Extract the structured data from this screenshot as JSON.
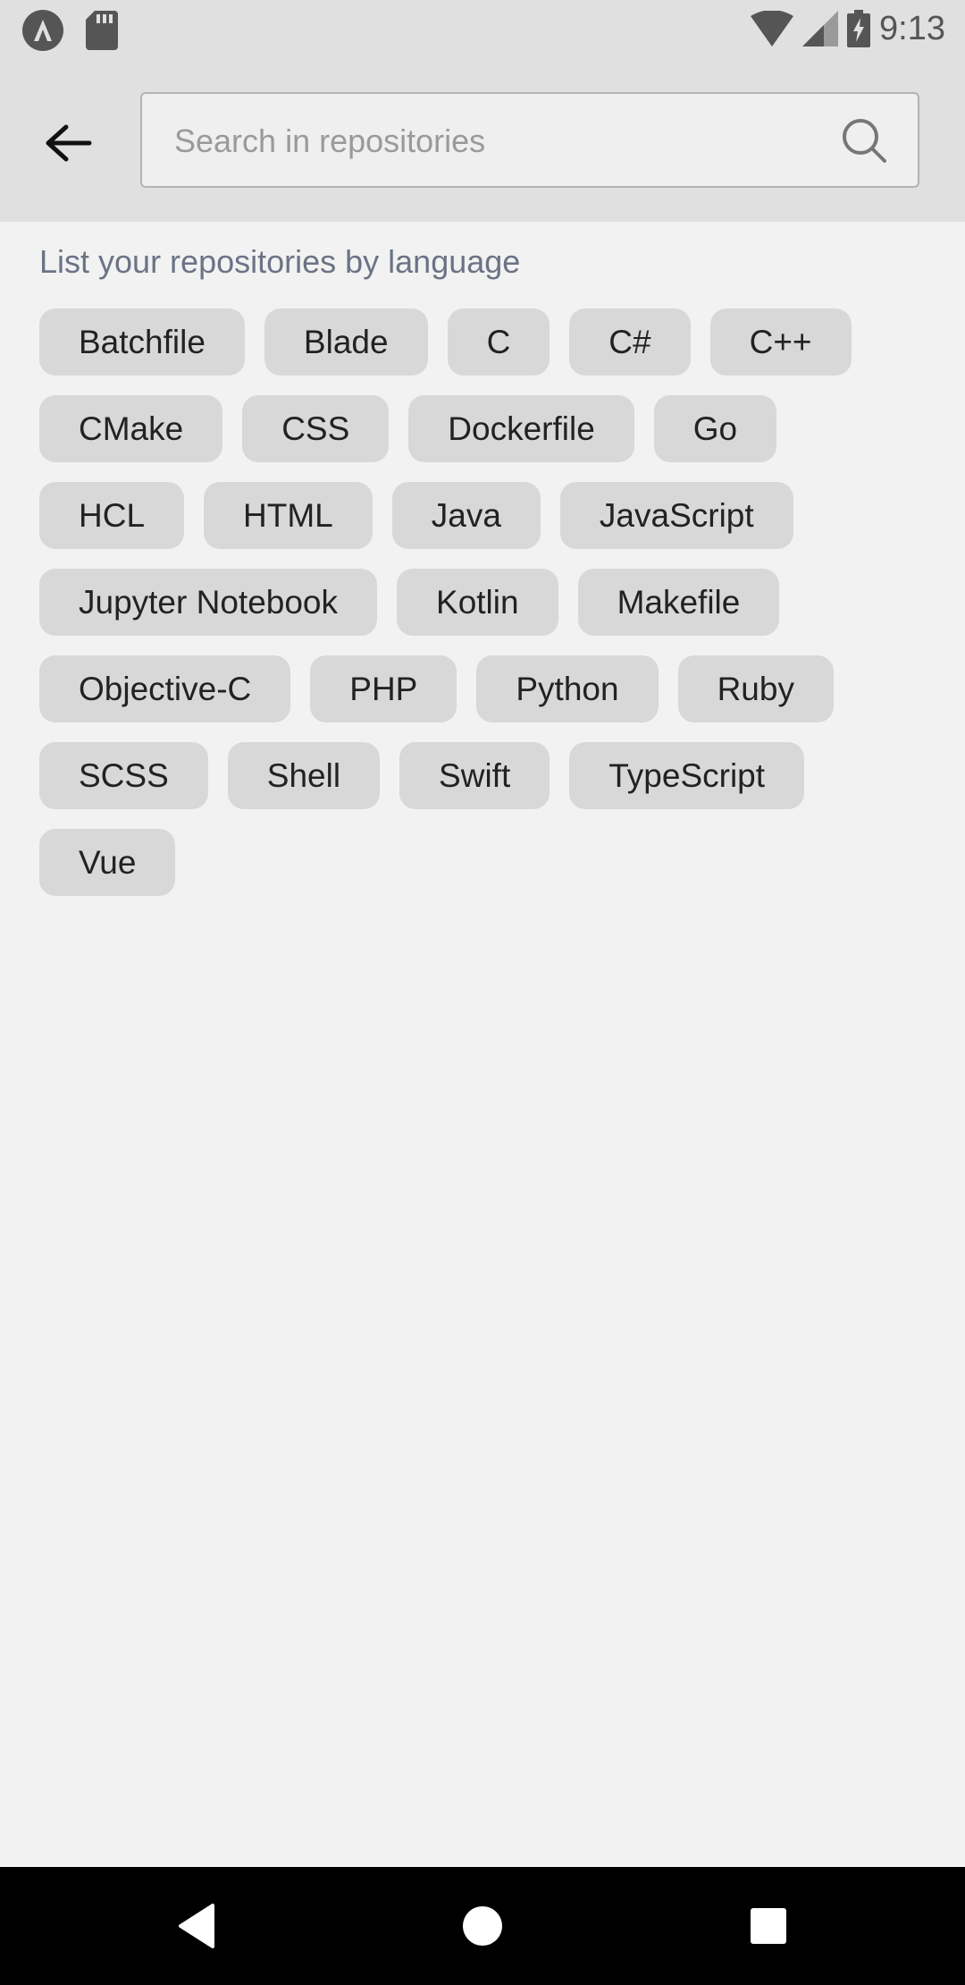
{
  "status_bar": {
    "time": "9:13",
    "icons": [
      "app-notification-icon",
      "sd-card-icon",
      "wifi-icon",
      "cell-signal-icon",
      "battery-charging-icon"
    ]
  },
  "header": {
    "back_icon": "arrow-left-icon",
    "search": {
      "placeholder": "Search in repositories",
      "value": "",
      "icon": "search-icon"
    }
  },
  "languages": {
    "label": "List your repositories by language",
    "items": [
      "Batchfile",
      "Blade",
      "C",
      "C#",
      "C++",
      "CMake",
      "CSS",
      "Dockerfile",
      "Go",
      "HCL",
      "HTML",
      "Java",
      "JavaScript",
      "Jupyter Notebook",
      "Kotlin",
      "Makefile",
      "Objective-C",
      "PHP",
      "Python",
      "Ruby",
      "SCSS",
      "Shell",
      "Swift",
      "TypeScript",
      "Vue"
    ]
  },
  "nav_bar": {
    "icons": [
      "back-triangle-icon",
      "home-circle-icon",
      "recents-square-icon"
    ]
  }
}
